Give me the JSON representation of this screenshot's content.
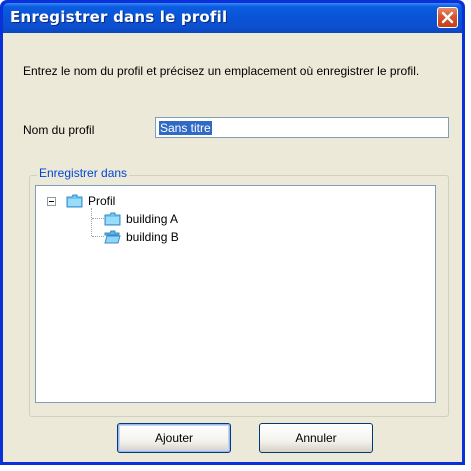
{
  "window": {
    "title": "Enregistrer dans le profil"
  },
  "dialog": {
    "description": "Entrez le nom du profil et précisez un emplacement où enregistrer le profil.",
    "name_label": "Nom du profil",
    "name_value": "Sans titre",
    "group_label": "Enregistrer dans"
  },
  "tree": {
    "root": {
      "label": "Profil",
      "expanded": true
    },
    "children": [
      {
        "label": "building A"
      },
      {
        "label": "building B"
      }
    ]
  },
  "buttons": {
    "add": "Ajouter",
    "cancel": "Annuler"
  },
  "colors": {
    "title_bar": "#0a54d7",
    "close_button": "#d7542e",
    "dialog_bg": "#ece9d8",
    "group_label": "#0046d5",
    "selection": "#316ac5",
    "folder": "#6ec6f3"
  }
}
